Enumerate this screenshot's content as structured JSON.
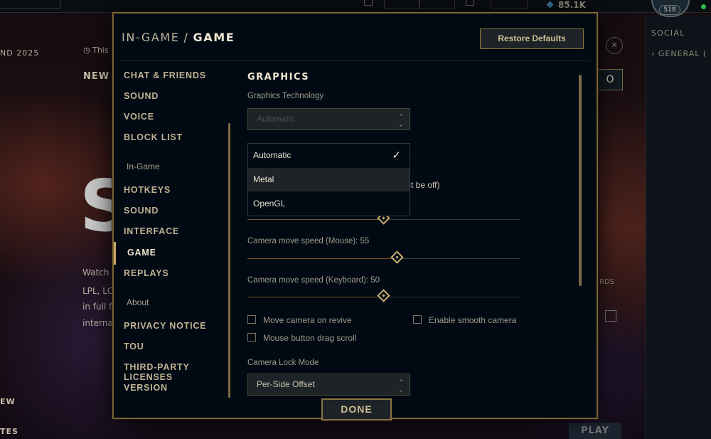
{
  "background": {
    "currency_value": "85.1K",
    "player_level": "518",
    "social_label": "SOCIAL",
    "general_label": "GENERAL (",
    "left_texts": [
      "ND 2025",
      "This",
      "NEW",
      "Watch",
      "LPL, LC",
      "in full fi",
      "interna",
      "EW",
      "TES"
    ],
    "big_letter": "S",
    "o_button": "O",
    "play_button": "PLAY",
    "rds_text": "RDS"
  },
  "modal": {
    "breadcrumb_parent": "IN-GAME",
    "breadcrumb_separator": "/",
    "breadcrumb_current": "GAME",
    "restore_defaults_label": "Restore Defaults",
    "done_label": "DONE"
  },
  "sidebar": {
    "items": [
      {
        "label": "CHAT & FRIENDS"
      },
      {
        "label": "SOUND"
      },
      {
        "label": "VOICE"
      },
      {
        "label": "BLOCK LIST"
      },
      {
        "label": "In-Game"
      },
      {
        "label": "HOTKEYS"
      },
      {
        "label": "SOUND"
      },
      {
        "label": "INTERFACE"
      },
      {
        "label": "GAME"
      },
      {
        "label": "REPLAYS"
      },
      {
        "label": "About"
      },
      {
        "label": "PRIVACY NOTICE"
      },
      {
        "label": "TOU"
      },
      {
        "label": "THIRD-PARTY LICENSES"
      },
      {
        "label": "VERSION"
      }
    ],
    "active": "GAME"
  },
  "content": {
    "section_title": "GRAPHICS",
    "graphics_technology_label": "Graphics Technology",
    "graphics_technology_value": "Automatic",
    "dropdown_options": [
      {
        "label": "Automatic",
        "selected": true
      },
      {
        "label": "Metal",
        "selected": false
      },
      {
        "label": "OpenGL",
        "selected": false
      }
    ],
    "partial_text": "st be off)",
    "sliders": [
      {
        "label": "",
        "value": 50
      },
      {
        "label": "Camera move speed (Mouse): 55",
        "value": 55
      },
      {
        "label": "Camera move speed (Keyboard): 50",
        "value": 50
      }
    ],
    "checkboxes": {
      "move_camera_on_revive": {
        "label": "Move camera on revive",
        "checked": false
      },
      "enable_smooth_camera": {
        "label": "Enable smooth camera",
        "checked": false
      },
      "mouse_button_drag_scroll": {
        "label": "Mouse button drag scroll",
        "checked": false
      }
    },
    "camera_lock_mode_label": "Camera Lock Mode",
    "camera_lock_mode_value": "Per-Side Offset"
  },
  "colors": {
    "gold": "#c8aa6e",
    "modal_bg": "#010a13",
    "text_light": "#f0e6d2",
    "text_muted": "#a09b8c"
  }
}
